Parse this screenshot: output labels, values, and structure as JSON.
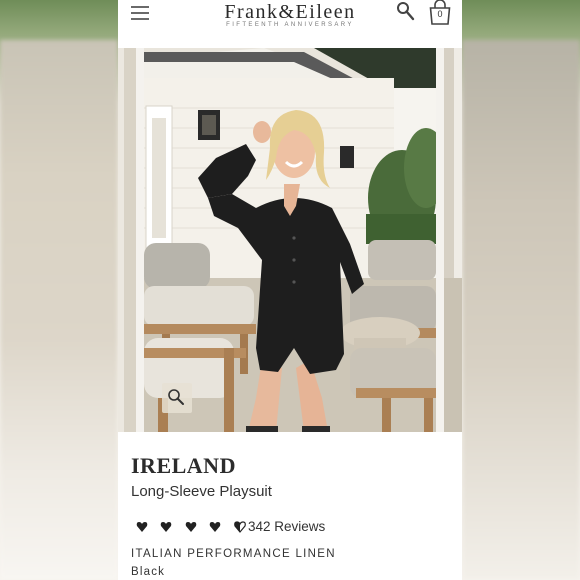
{
  "header": {
    "brand": "Frank&Eileen",
    "tagline": "FIFTEENTH ANNIVERSARY",
    "cart_count": "0"
  },
  "icons": {
    "menu": "hamburger-menu-icon",
    "search": "search-icon",
    "cart": "shopping-bag-icon",
    "zoom": "zoom-magnifier-icon",
    "rating": "heart-icon"
  },
  "product": {
    "name": "IRELAND",
    "subtitle": "Long-Sleeve Playsuit",
    "rating_value": 4.5,
    "rating_max": 5,
    "reviews_label": "342 Reviews",
    "material": "ITALIAN PERFORMANCE LINEN",
    "color": "Black"
  },
  "colors": {
    "text_dark": "#2c2c2c",
    "garment": "#1e1e1e",
    "page_white": "#ffffff"
  }
}
